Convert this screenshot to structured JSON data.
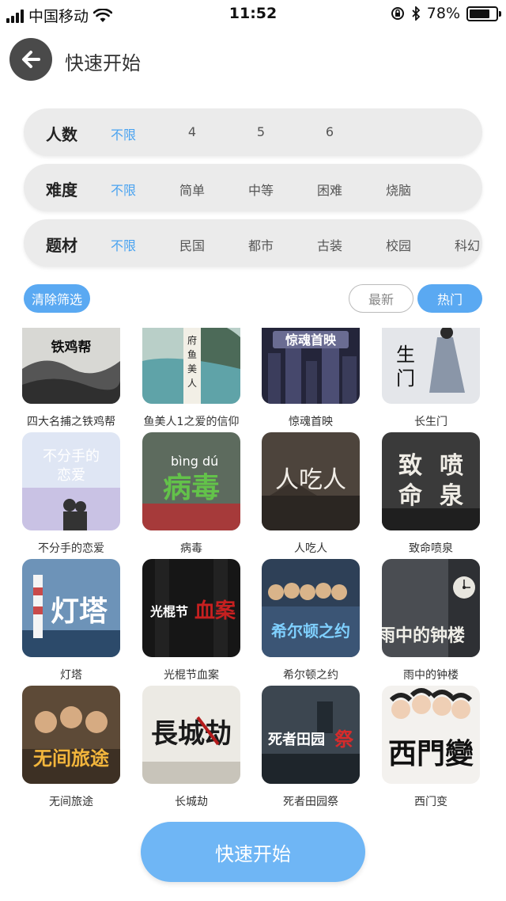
{
  "status_bar": {
    "carrier": "中国移动",
    "time": "11:52",
    "battery": "78%"
  },
  "header": {
    "title": "快速开始"
  },
  "filters": {
    "players": {
      "label": "人数",
      "options": [
        "不限",
        "4",
        "5",
        "6"
      ],
      "selected": "不限"
    },
    "difficulty": {
      "label": "难度",
      "options": [
        "不限",
        "简单",
        "中等",
        "困难",
        "烧脑"
      ],
      "selected": "不限"
    },
    "theme": {
      "label": "题材",
      "options": [
        "不限",
        "民国",
        "都市",
        "古装",
        "校园",
        "科幻"
      ],
      "selected": "不限"
    }
  },
  "actions": {
    "clear": "清除筛选",
    "sort_newest": "最新",
    "sort_hot": "热门",
    "sort_selected": "热门"
  },
  "games": [
    {
      "title": "四大名捕之铁鸡帮",
      "cover_text": "四大名捕之铁鸡帮"
    },
    {
      "title": "鱼美人1之爱的信仰",
      "cover_text": "府鱼美人"
    },
    {
      "title": "惊魂首映",
      "cover_text": "惊魂首映"
    },
    {
      "title": "长生门",
      "cover_text": "长生门"
    },
    {
      "title": "不分手的恋爱",
      "cover_text": "不分手的恋爱"
    },
    {
      "title": "病毒",
      "cover_text": "病毒"
    },
    {
      "title": "人吃人",
      "cover_text": "人吃人"
    },
    {
      "title": "致命喷泉",
      "cover_text": "致命喷泉"
    },
    {
      "title": "灯塔",
      "cover_text": "灯塔"
    },
    {
      "title": "光棍节血案",
      "cover_text": "光棍节血案"
    },
    {
      "title": "希尔顿之约",
      "cover_text": "希尔顿之约"
    },
    {
      "title": "雨中的钟楼",
      "cover_text": "雨中的钟楼"
    },
    {
      "title": "无间旅途",
      "cover_text": "无间旅途"
    },
    {
      "title": "长城劫",
      "cover_text": "长城劫"
    },
    {
      "title": "死者田园祭",
      "cover_text": "死者田园祭"
    },
    {
      "title": "西门变",
      "cover_text": "西门变"
    }
  ],
  "footer": {
    "start_label": "快速开始"
  },
  "colors": {
    "accent": "#5aa9f2",
    "button": "#6fb6f5",
    "back": "#4a4a4a"
  }
}
